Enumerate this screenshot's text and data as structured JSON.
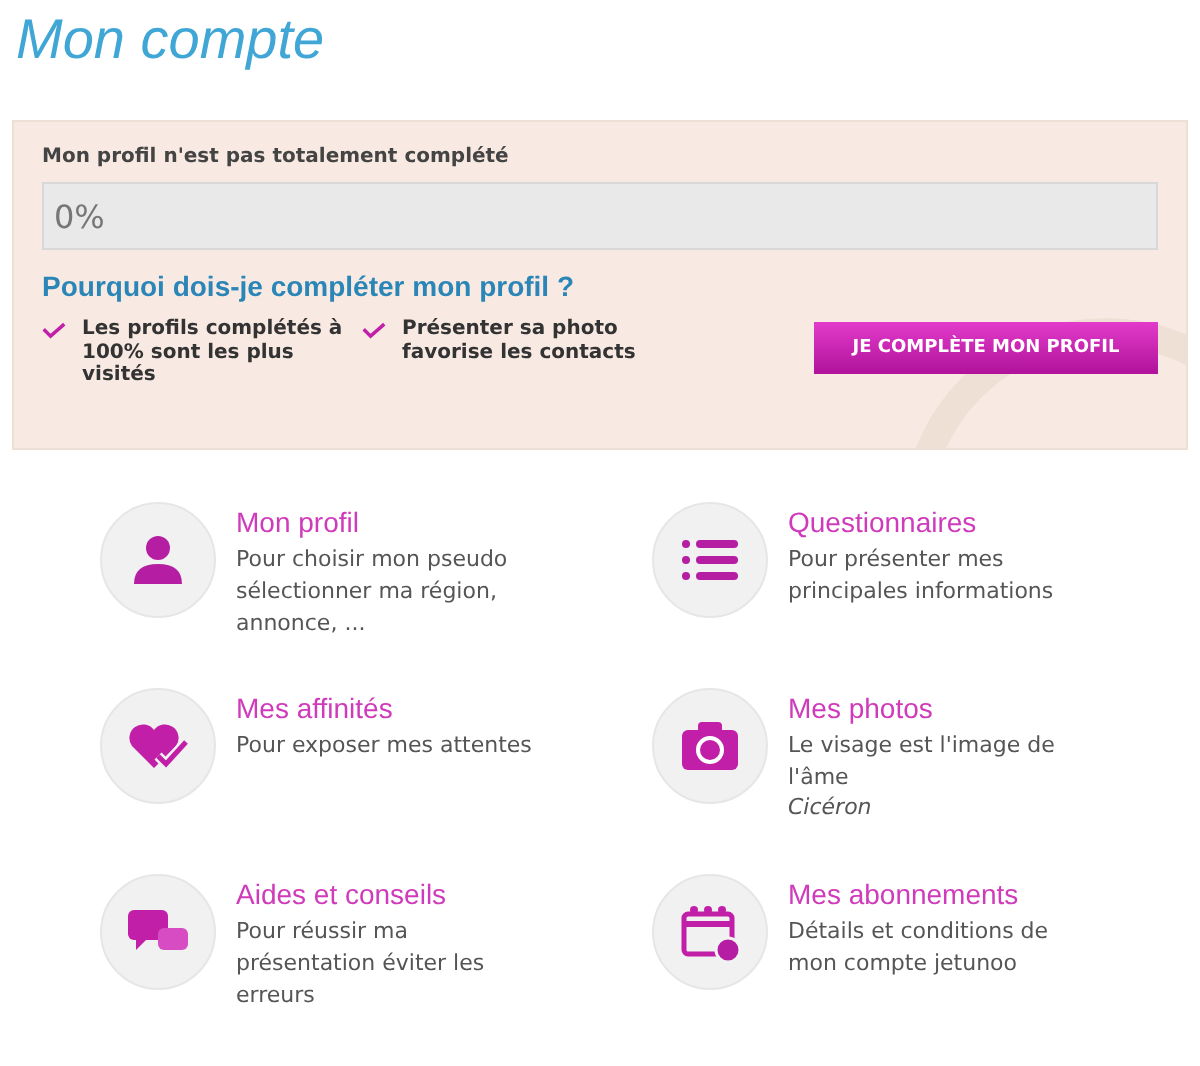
{
  "page_title": "Mon compte",
  "profile_box": {
    "heading": "Mon profil n'est pas totalement complété",
    "progress": {
      "level": 0,
      "reading": "0%"
    },
    "question": "Pourquoi dois-je compléter mon profil ?",
    "reasons": [
      "Les profils complétés à 100% sont les plus visités",
      "Présenter sa photo favorise les contacts"
    ],
    "button": "JE COMPLÈTE MON PROFIL"
  },
  "sections": [
    {
      "title": "Mon profil",
      "description": "Pour choisir mon pseudo sélectionner ma région, annonce, ..."
    },
    {
      "title": "Questionnaires",
      "description": "Pour présenter mes principales informations"
    },
    {
      "title": "Mes affinités",
      "description": "Pour exposer mes attentes"
    },
    {
      "title": "Mes photos",
      "description": "Le visage est l'image de l'âme",
      "attribution": "Cicéron"
    },
    {
      "title": "Aides et conseils",
      "description": "Pour réussir ma présentation éviter les erreurs"
    },
    {
      "title": "Mes abonnements",
      "description": "Détails et conditions de mon compte jetunoo"
    }
  ]
}
